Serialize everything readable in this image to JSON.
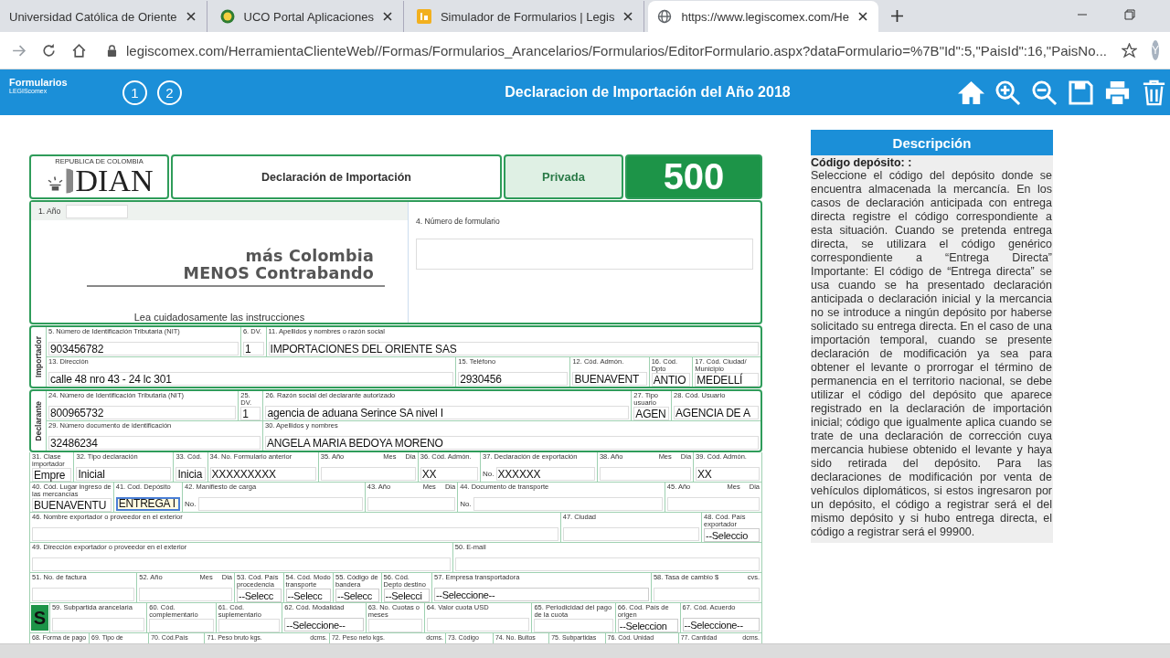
{
  "browser": {
    "tabs": [
      {
        "title": "Universidad Católica de Oriente",
        "selected": false
      },
      {
        "title": "UCO Portal Aplicaciones",
        "selected": false
      },
      {
        "title": "Simulador de Formularios | Legis",
        "selected": false
      },
      {
        "title": "https://www.legiscomex.com/He",
        "selected": true
      }
    ],
    "url": "legiscomex.com/HerramientaClienteWeb//Formas/Formularios_Arancelarios/Formularios/EditorFormulario.aspx?dataFormulario=%7B\"Id\":5,\"PaisId\":16,\"PaisNo...",
    "avatar": "Y"
  },
  "app": {
    "logo": "Formularios",
    "logo_sub": "LEGIScomex",
    "steps": [
      "1",
      "2"
    ],
    "title": "Declaracion de Importación del Año 2018"
  },
  "form": {
    "header": {
      "republic": "REPUBLICA DE COLOMBIA",
      "agency": "DIAN",
      "title": "Declaración de Importación",
      "type": "Privada",
      "number": "500"
    },
    "year_label": "1. Año",
    "slogan": [
      "más Colombia",
      "MENOS Contrabando"
    ],
    "instructions": "Lea cuidadosamente las instrucciones",
    "form_number_label": "4. Número de formulario",
    "sections": [
      {
        "side": "Importador",
        "rows": [
          {
            "fields": [
              {
                "label": "5. Número de Identificación Tributaria (NIT)",
                "kind": "text",
                "value": "903456782"
              },
              {
                "label": "6. DV.",
                "kind": "text",
                "value": "1"
              },
              {
                "label": "11. Apellidos y nombres o razón social",
                "kind": "text",
                "value": "IMPORTACIONES DEL ORIENTE SAS"
              }
            ]
          },
          {
            "fields": [
              {
                "label": "13. Dirección",
                "kind": "text",
                "value": "calle 48 nro 43 - 24 lc 301"
              },
              {
                "label": "15. Teléfono",
                "kind": "text",
                "value": "2930456"
              },
              {
                "label": "12. Cód. Admón.",
                "kind": "text",
                "value": "BUENAVENT"
              },
              {
                "label": "16. Cód. Dpto",
                "kind": "text",
                "value": "ANTIO"
              },
              {
                "label": "17. Cód. Ciudad/ Municipio",
                "kind": "text",
                "value": "MEDELLÍ"
              }
            ]
          }
        ]
      },
      {
        "side": "Declarante",
        "rows": [
          {
            "fields": [
              {
                "label": "24. Número de Identificación Tributaria (NIT)",
                "kind": "text",
                "value": "800965732"
              },
              {
                "label": "25. DV.",
                "kind": "text",
                "value": "1"
              },
              {
                "label": "26. Razón social del declarante autorizado",
                "kind": "text",
                "value": "agencia de aduana Serince SA nivel I"
              },
              {
                "label": "27. Tipo usuario",
                "kind": "text",
                "value": "AGEN"
              },
              {
                "label": "28. Cód. Usuario",
                "kind": "text",
                "value": "AGENCIA DE A"
              }
            ]
          },
          {
            "fields": [
              {
                "label": "29. Número documento de identificación",
                "kind": "text",
                "value": "32486234"
              },
              {
                "label": "30. Apellidos y nombres",
                "kind": "text",
                "value": "ANGELA MARIA BEDOYA MORENO"
              }
            ]
          }
        ]
      },
      {
        "rows": [
          {
            "fields": [
              {
                "label": "31. Clase importador",
                "kind": "text",
                "value": "Empre"
              },
              {
                "label": "32. Tipo declaración",
                "kind": "text",
                "value": "Inicial"
              },
              {
                "label": "33. Cód.",
                "kind": "text",
                "value": "Inicia"
              },
              {
                "label": "34. No. Formulario anterior",
                "kind": "text",
                "value": "XXXXXXXXX"
              },
              {
                "label": "35. Año",
                "sub": [
                  "Mes",
                  "Dia"
                ],
                "kind": "text"
              },
              {
                "label": "36. Cód. Admón.",
                "kind": "text",
                "value": "XX"
              },
              {
                "label": "37. Declaración de exportación",
                "kind": "text",
                "prefix": "No.",
                "value": "XXXXXX"
              },
              {
                "label": "38. Año",
                "sub": [
                  "Mes",
                  "Dia"
                ],
                "kind": "text"
              },
              {
                "label": "39. Cód. Admón.",
                "kind": "text",
                "value": "XX"
              }
            ]
          },
          {
            "fields": [
              {
                "label": "40. Cód. Lugar ingreso de las mercancías",
                "kind": "text",
                "value": "BUENAVENTU"
              },
              {
                "label": "41. Cod. Depósito",
                "kind": "text",
                "value": "ENTREGA I",
                "focused": true
              },
              {
                "label": "42. Manifiesto de carga",
                "kind": "text",
                "prefix": "No."
              },
              {
                "label": "43. Año",
                "sub": [
                  "Mes",
                  "Dia"
                ],
                "kind": "text"
              },
              {
                "label": "44. Documento de transporte",
                "kind": "text",
                "prefix": "No."
              },
              {
                "label": "45. Año",
                "sub": [
                  "Mes",
                  "Dia"
                ],
                "kind": "text"
              }
            ]
          },
          {
            "fields": [
              {
                "label": "46. Nombre exportador o proveedor en el exterior",
                "kind": "text"
              },
              {
                "label": "47. Ciudad",
                "kind": "text"
              },
              {
                "label": "48. Cód. País exportador",
                "kind": "select",
                "value": "--Seleccio"
              }
            ]
          },
          {
            "fields": [
              {
                "label": "49. Dirección exportador o proveedor en el exterior",
                "kind": "text"
              },
              {
                "label": "50. E-mail",
                "kind": "text"
              }
            ]
          },
          {
            "fields": [
              {
                "label": "51. No. de factura",
                "kind": "text"
              },
              {
                "label": "52. Año",
                "sub": [
                  "Mes",
                  "Dia"
                ],
                "kind": "text"
              },
              {
                "label": "53. Cód. País procedencia",
                "kind": "select",
                "value": "--Selecc"
              },
              {
                "label": "54. Cód. Modo transporte",
                "kind": "select",
                "value": "--Selecc"
              },
              {
                "label": "55. Código de bandera",
                "kind": "select",
                "value": "--Selecc"
              },
              {
                "label": "56. Cód. Depto destino",
                "kind": "select",
                "value": "--Selecci"
              },
              {
                "label": "57. Empresa transportadora",
                "kind": "select",
                "value": "--Seleccione--"
              },
              {
                "label": "58. Tasa de cambio $",
                "unit": "cvs.",
                "kind": "text"
              }
            ]
          },
          {
            "fields": [
              {
                "label": "S",
                "kind": "badge"
              },
              {
                "label": "59. Subpartida arancelaria",
                "kind": "text"
              },
              {
                "label": "60. Cód. complementario",
                "kind": "text"
              },
              {
                "label": "61. Cód. suplementario",
                "kind": "text"
              },
              {
                "label": "62. Cód. Modalidad",
                "kind": "select",
                "value": "--Seleccione--"
              },
              {
                "label": "63. No. Cuotas o meses",
                "kind": "text"
              },
              {
                "label": "64. Valor cuota USD",
                "kind": "text"
              },
              {
                "label": "65. Periodicidad del pago de la cuota",
                "kind": "text"
              },
              {
                "label": "66. Cód. País de origen",
                "kind": "select",
                "value": "--Seleccion"
              },
              {
                "label": "67. Cód. Acuerdo",
                "kind": "select",
                "value": "--Seleccione--"
              }
            ]
          },
          {
            "fields": [
              {
                "label": "68. Forma de pago",
                "kind": "label"
              },
              {
                "label": "69. Tipo de",
                "kind": "label"
              },
              {
                "label": "70. Cód.País",
                "kind": "label"
              },
              {
                "label": "71. Peso bruto kgs.",
                "unit": "dcms.",
                "kind": "label"
              },
              {
                "label": "72. Peso neto kgs.",
                "unit": "dcms.",
                "kind": "label"
              },
              {
                "label": "73. Código",
                "kind": "label"
              },
              {
                "label": "74. No. Bultos",
                "kind": "label"
              },
              {
                "label": "75. Subpartidas",
                "kind": "label"
              },
              {
                "label": "76. Cód. Unidad",
                "kind": "label"
              },
              {
                "label": "77. Cantidad",
                "unit": "dcms.",
                "kind": "label"
              }
            ]
          }
        ]
      }
    ]
  },
  "description": {
    "title": "Descripción",
    "heading": "Código depósito: :",
    "text": "Seleccione el código del depósito donde se encuentra almacenada la mercancía. En los casos de declaración anticipada con entrega directa registre el código correspondiente a esta situación. Cuando se pretenda entrega directa, se utilizara el código genérico correspondiente a “Entrega Directa” Importante: El código de “Entrega directa” se usa cuando se ha presentado declaración anticipada o declaración inicial y la mercancia no se introduce a ningún depósito por haberse solicitado su entrega directa. En el caso de una importación temporal, cuando se presente declaración de modificación ya sea para obtener el levante o prorrogar el término de permanencia en el territorio nacional, se debe utilizar el código del depósito que aparece registrado en la declaración de importación inicial; código que igualmente aplica cuando se trate de una declaración de corrección cuya mercancia hubiese obtenido el levante y haya sido retirada del depósito. Para las declaraciones de modificación por venta de vehículos diplomáticos, si estos ingresaron por un depósito, el código a registrar será el del mismo depósito y si hubo entrega directa, el código a registrar será el 99900."
  }
}
